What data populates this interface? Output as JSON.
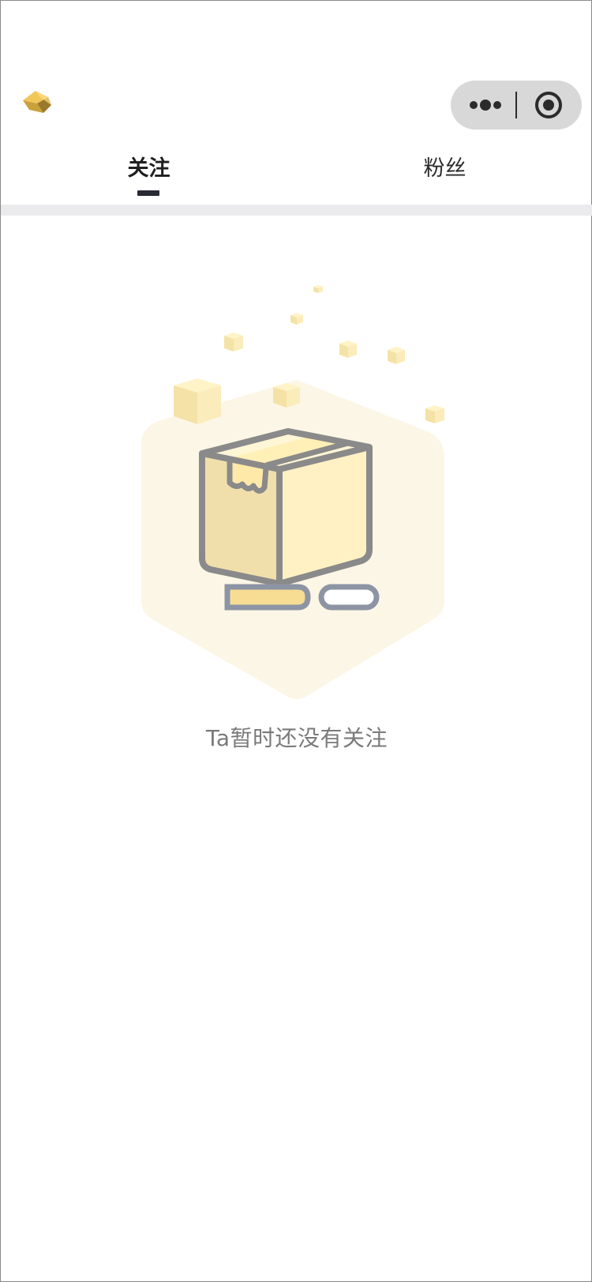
{
  "header": {
    "back_icon": "brand-chevron-icon",
    "capsule": {
      "more_icon": "more-dots-icon",
      "close_icon": "target-close-icon"
    }
  },
  "tabs": [
    {
      "label": "关注",
      "active": true
    },
    {
      "label": "粉丝",
      "active": false
    }
  ],
  "empty_state": {
    "icon": "empty-box-icon",
    "message": "Ta暂时还没有关注"
  },
  "colors": {
    "accent": "#2a2a35",
    "separator": "#ebebed",
    "illustration_bg": "#fcf6e6",
    "box_fill": "#f1dfab",
    "box_stroke": "#8a8a8a"
  }
}
